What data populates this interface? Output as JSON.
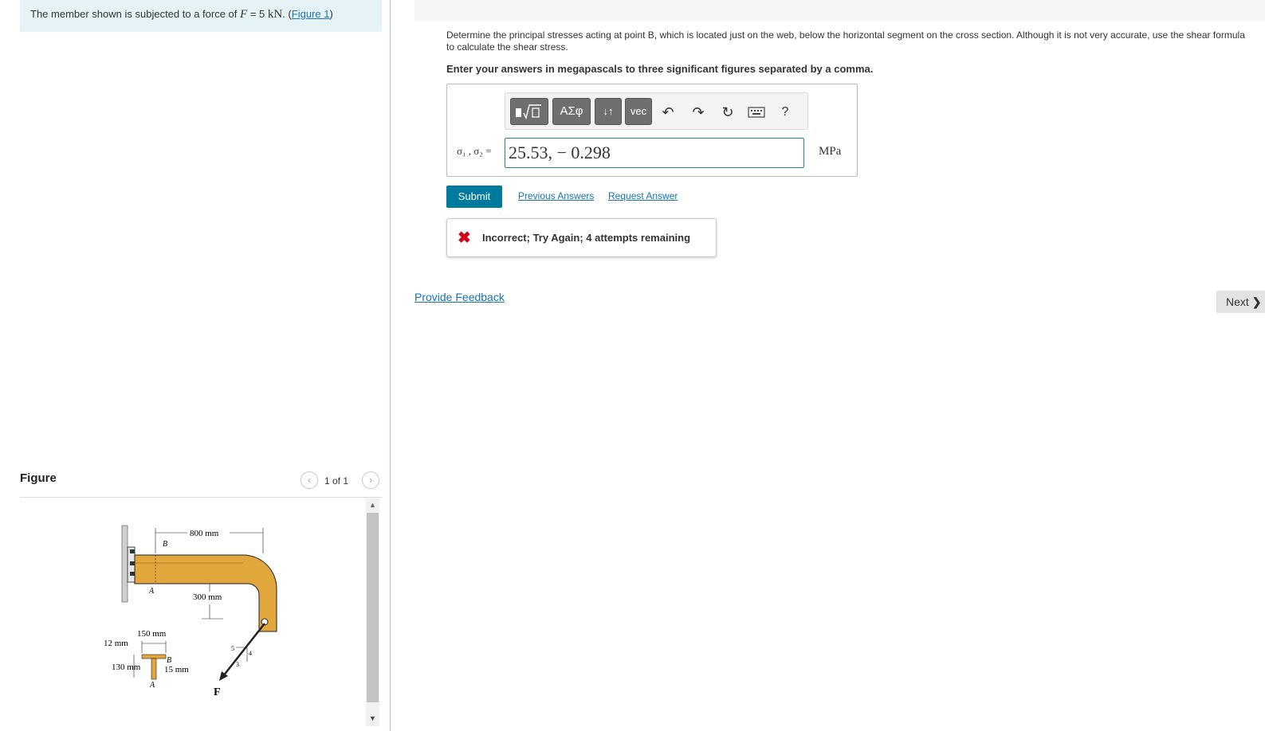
{
  "problem": {
    "text_prefix": "The member shown is subjected to a force of ",
    "force_symbol": "F",
    "force_value": " = 5 ",
    "force_unit": "kN",
    "figure_link_open": ". (",
    "figure_link": "Figure 1",
    "figure_link_close": ")"
  },
  "figure_panel": {
    "title": "Figure",
    "counter": "1 of 1",
    "prev_icon": "chevron-left-icon",
    "next_icon": "chevron-right-icon"
  },
  "figure": {
    "dim_800": "800 mm",
    "dim_300": "300 mm",
    "dim_150": "150 mm",
    "dim_12": "12 mm",
    "dim_130": "130 mm",
    "dim_15": "15 mm",
    "label_B": "B",
    "label_A": "A",
    "label_B2": "B",
    "label_A2": "A",
    "label_F": "F",
    "slope_5": "5",
    "slope_4": "4",
    "slope_3": "3",
    "member_color": "#e1a63c"
  },
  "question": {
    "text": "Determine the principal stresses acting at point B, which is located just on the web, below the horizontal segment on the cross section. Although it is not very accurate, use the shear formula to calculate the shear stress.",
    "instructions": "Enter your answers in megapascals to three significant figures separated by a comma."
  },
  "toolbar": {
    "templates_icon": "fraction-sqrt-templates-icon",
    "greek": "ΑΣφ",
    "arrows": "↓↑",
    "vec": "vec",
    "undo_icon": "undo-icon",
    "redo_icon": "redo-icon",
    "reset_icon": "reset-icon",
    "keyboard_icon": "keyboard-icon",
    "help": "?"
  },
  "answer": {
    "variable_label": "σ₁ , σ₂ =",
    "value": "25.53, − 0.298",
    "unit": "MPa"
  },
  "actions": {
    "submit": "Submit",
    "previous_answers": "Previous Answers",
    "request_answer": "Request Answer"
  },
  "feedback": {
    "icon": "x-mark-icon",
    "text": "Incorrect; Try Again; 4 attempts remaining",
    "color": "#d0021b"
  },
  "footer": {
    "provide_feedback": "Provide Feedback",
    "next": "Next"
  },
  "colors": {
    "accent": "#007a9c",
    "link": "#1a73b0",
    "problem_bg": "#e6f3f6"
  }
}
